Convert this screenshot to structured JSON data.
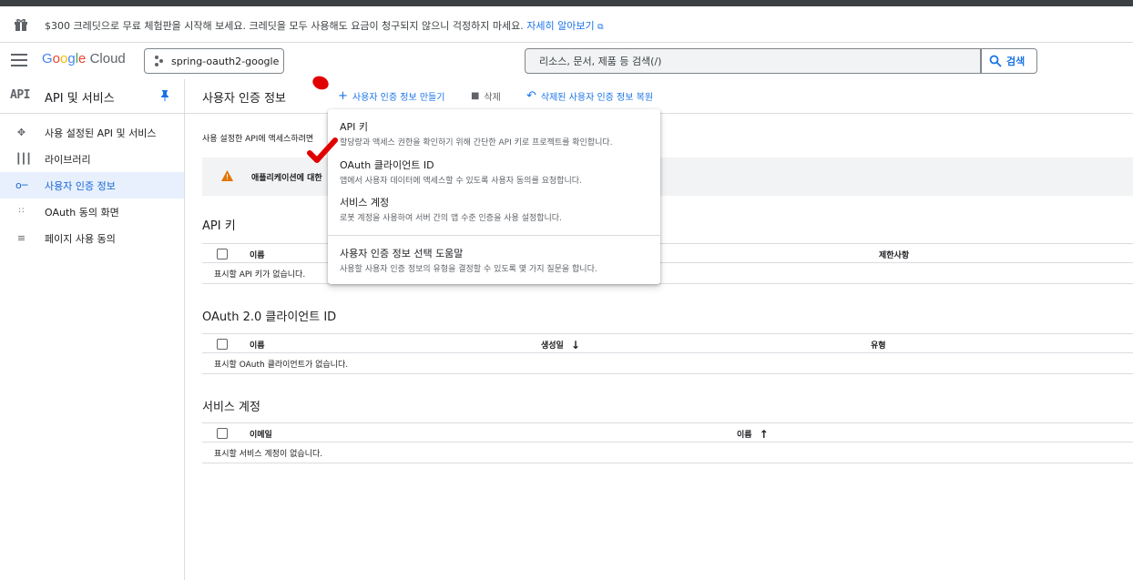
{
  "banner": {
    "icon": "gift-icon",
    "text": "$300 크레딧으로 무료 체험판을 시작해 보세요. 크레딧을 모두 사용해도 요금이 청구되지 않으니 걱정하지 마세요.",
    "link": "자세히 알아보기"
  },
  "header": {
    "logo_google": [
      "G",
      "o",
      "o",
      "g",
      "l",
      "e"
    ],
    "logo_cloud": "Cloud",
    "project": "spring-oauth2-google",
    "search_placeholder": "리소스, 문서, 제품 등 검색(/)",
    "search_button": "검색"
  },
  "sidebar": {
    "icon_text": "API",
    "title": "API 및 서비스",
    "items": [
      {
        "label": "사용 설정된 API 및 서비스",
        "icon": "move-icon"
      },
      {
        "label": "라이브러리",
        "icon": "library-icon"
      },
      {
        "label": "사용자 인증 정보",
        "icon": "key-icon",
        "active": true
      },
      {
        "label": "OAuth 동의 화면",
        "icon": "consent-icon"
      },
      {
        "label": "페이지 사용 동의",
        "icon": "settings-list-icon"
      }
    ]
  },
  "toolbar": {
    "title": "사용자 인증 정보",
    "create": "사용자 인증 정보 만들기",
    "delete": "삭제",
    "restore": "삭제된 사용자 인증 정보 복원"
  },
  "main": {
    "description": "사용 설정한 API에 액세스하려면",
    "warning": "애플리케이션에 대한"
  },
  "sections": {
    "api_keys": {
      "title": "API 키",
      "columns": [
        "이름",
        "제한사항"
      ],
      "empty": "표시할 API 키가 없습니다."
    },
    "oauth": {
      "title": "OAuth 2.0 클라이언트 ID",
      "columns": [
        "이름",
        "생성일",
        "유형"
      ],
      "empty": "표시할 OAuth 클라이언트가 없습니다."
    },
    "service": {
      "title": "서비스 계정",
      "columns": [
        "이메일",
        "이름"
      ],
      "empty": "표시할 서비스 계정이 없습니다."
    }
  },
  "dropdown": [
    {
      "title": "API 키",
      "subtitle": "할당량과 액세스 권한을 확인하기 위해 간단한 API 키로 프로젝트를 확인합니다."
    },
    {
      "title": "OAuth 클라이언트 ID",
      "subtitle": "앱에서 사용자 데이터에 액세스할 수 있도록 사용자 동의를 요청합니다."
    },
    {
      "title": "서비스 계정",
      "subtitle": "로봇 계정을 사용하여 서버 간의 앱 수준 인증을 사용 설정합니다."
    },
    {
      "title": "사용자 인증 정보 선택 도움말",
      "subtitle": "사용할 사용자 인증 정보의 유형을 결정할 수 있도록 몇 가지 질문을 합니다."
    }
  ],
  "colors": {
    "accent": "#1a73e8",
    "active_bg": "#e8f0fe",
    "annotation": "#e00000",
    "warning": "#e37400"
  }
}
